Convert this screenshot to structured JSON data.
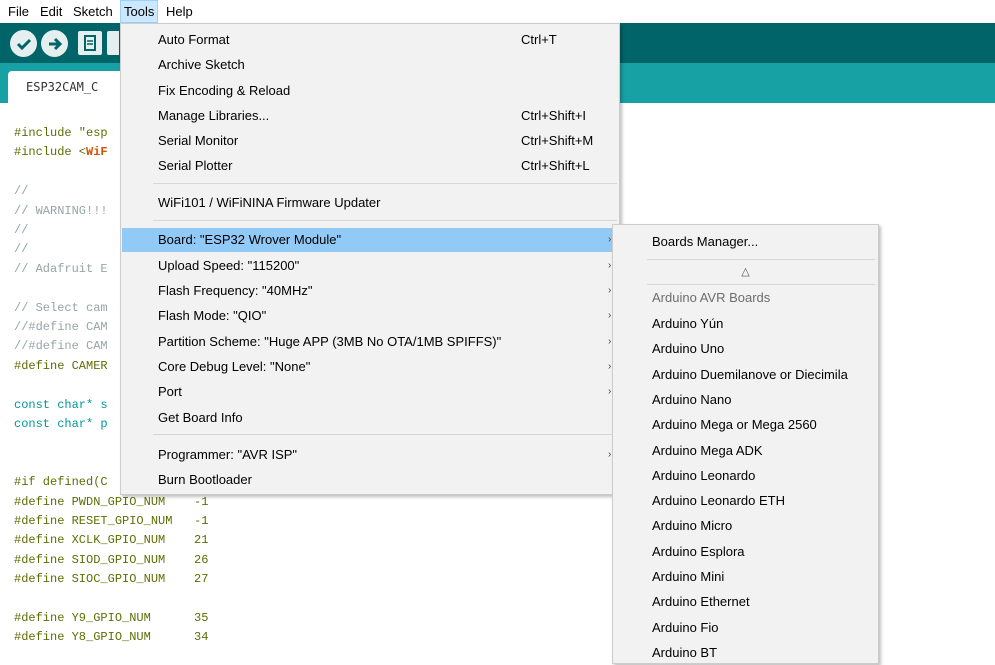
{
  "menubar": {
    "items": [
      "File",
      "Edit",
      "Sketch",
      "Tools",
      "Help"
    ]
  },
  "tab": {
    "label": "ESP32CAM_C"
  },
  "code": [
    {
      "t": "#include \"esp",
      "c": "pp"
    },
    {
      "t": "#include <",
      "c": "pp",
      "lib": "WiF"
    },
    {
      "t": "",
      "c": "plain"
    },
    {
      "t": "//",
      "c": "cm"
    },
    {
      "t": "// WARNING!!!",
      "c": "cm"
    },
    {
      "t": "//",
      "c": "cm"
    },
    {
      "t": "//",
      "c": "cm"
    },
    {
      "t": "// Adafruit E",
      "c": "cm"
    },
    {
      "t": "",
      "c": "plain"
    },
    {
      "t": "// Select cam",
      "c": "cm"
    },
    {
      "t": "//#define CAM",
      "c": "cm"
    },
    {
      "t": "//#define CAM",
      "c": "cm"
    },
    {
      "t": "#define CAMER",
      "c": "pp"
    },
    {
      "t": "",
      "c": "plain"
    },
    {
      "t": "const char* s",
      "c": "kw"
    },
    {
      "t": "const char* p",
      "c": "kw"
    },
    {
      "t": "",
      "c": "plain"
    },
    {
      "t": "",
      "c": "plain"
    },
    {
      "t": "#if defined(C",
      "c": "pp"
    },
    {
      "t": "#define PWDN_GPIO_NUM    -1",
      "c": "pp"
    },
    {
      "t": "#define RESET_GPIO_NUM   -1",
      "c": "pp"
    },
    {
      "t": "#define XCLK_GPIO_NUM    21",
      "c": "pp"
    },
    {
      "t": "#define SIOD_GPIO_NUM    26",
      "c": "pp"
    },
    {
      "t": "#define SIOC_GPIO_NUM    27",
      "c": "pp"
    },
    {
      "t": "",
      "c": "plain"
    },
    {
      "t": "#define Y9_GPIO_NUM      35",
      "c": "pp"
    },
    {
      "t": "#define Y8_GPIO_NUM      34",
      "c": "pp"
    }
  ],
  "tools_menu": {
    "auto_format": {
      "label": "Auto Format",
      "shortcut": "Ctrl+T"
    },
    "archive_sketch": {
      "label": "Archive Sketch"
    },
    "fix_encoding": {
      "label": "Fix Encoding & Reload"
    },
    "manage_libraries": {
      "label": "Manage Libraries...",
      "shortcut": "Ctrl+Shift+I"
    },
    "serial_monitor": {
      "label": "Serial Monitor",
      "shortcut": "Ctrl+Shift+M"
    },
    "serial_plotter": {
      "label": "Serial Plotter",
      "shortcut": "Ctrl+Shift+L"
    },
    "wifi_updater": {
      "label": "WiFi101 / WiFiNINA Firmware Updater"
    },
    "board": {
      "label": "Board: \"ESP32 Wrover Module\""
    },
    "upload_speed": {
      "label": "Upload Speed: \"115200\""
    },
    "flash_frequency": {
      "label": "Flash Frequency: \"40MHz\""
    },
    "flash_mode": {
      "label": "Flash Mode: \"QIO\""
    },
    "partition_scheme": {
      "label": "Partition Scheme: \"Huge APP (3MB No OTA/1MB SPIFFS)\""
    },
    "core_debug": {
      "label": "Core Debug Level: \"None\""
    },
    "port": {
      "label": "Port"
    },
    "board_info": {
      "label": "Get Board Info"
    },
    "programmer": {
      "label": "Programmer: \"AVR ISP\""
    },
    "burn_bootloader": {
      "label": "Burn Bootloader"
    }
  },
  "boards_submenu": {
    "boards_manager": "Boards Manager...",
    "scroll_up_glyph": "△",
    "group_label": "Arduino AVR Boards",
    "boards": [
      "Arduino Yún",
      "Arduino Uno",
      "Arduino Duemilanove or Diecimila",
      "Arduino Nano",
      "Arduino Mega or Mega 2560",
      "Arduino Mega ADK",
      "Arduino Leonardo",
      "Arduino Leonardo ETH",
      "Arduino Micro",
      "Arduino Esplora",
      "Arduino Mini",
      "Arduino Ethernet",
      "Arduino Fio",
      "Arduino BT"
    ]
  },
  "colors": {
    "toolbar": "#006468",
    "tabbar": "#17a1a5",
    "highlight": "#91c9f7"
  }
}
